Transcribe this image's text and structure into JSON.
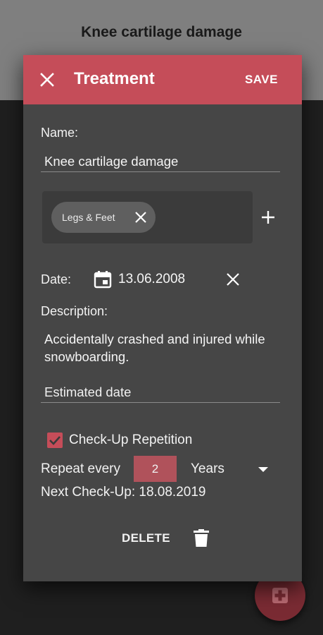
{
  "background": {
    "title": "Knee cartilage damage"
  },
  "fab": {
    "icon": "medical-plus-icon"
  },
  "dialog": {
    "title": "Treatment",
    "save_label": "SAVE",
    "close_icon": "close-icon",
    "name_label": "Name:",
    "name_value": "Knee cartilage damage",
    "tags": [
      {
        "label": "Legs & Feet"
      }
    ],
    "date_label": "Date:",
    "date_value": "13.06.2008",
    "description_label": "Description:",
    "description_value": "Accidentally crashed and injured while snowboarding.",
    "estimated_date_label": "Estimated date",
    "checkup_label": "Check-Up Repetition",
    "checkup_checked": true,
    "repeat_label": "Repeat every",
    "repeat_value": "2",
    "repeat_unit": "Years",
    "next_checkup": "Next Check-Up: 18.08.2019",
    "delete_label": "DELETE"
  },
  "colors": {
    "accent": "#c54d59",
    "dialog_bg": "#464646",
    "page_top": "#7f7f7f",
    "page_bottom": "#1f1f1f"
  }
}
